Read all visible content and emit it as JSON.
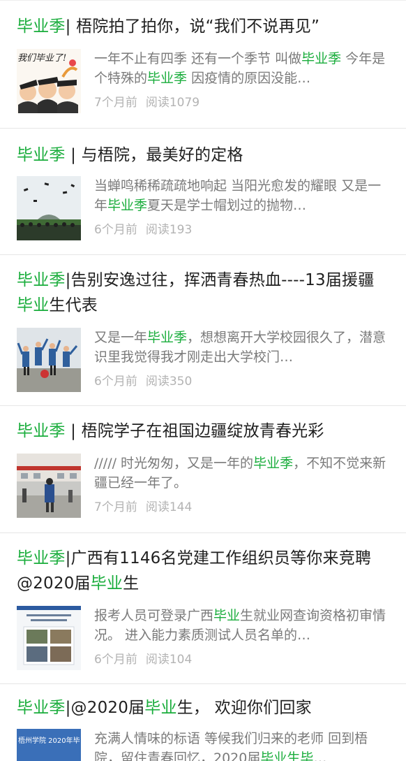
{
  "articles": [
    {
      "title": [
        {
          "t": "毕业季",
          "h": true
        },
        {
          "t": "| 梧院拍了拍你，说“我们不说再见”",
          "h": false
        }
      ],
      "digest": [
        {
          "t": "一年不止有四季 还有一个季节 叫做",
          "h": false
        },
        {
          "t": "毕业季",
          "h": true
        },
        {
          "t": " 今年是个特殊的",
          "h": false
        },
        {
          "t": "毕业季",
          "h": true
        },
        {
          "t": " 因疫情的原因没能…",
          "h": false
        }
      ],
      "time": "7个月前",
      "reads": "阅读1079",
      "thumb": "cartoon-graduates",
      "thumb_text": "我们毕业了!"
    },
    {
      "title": [
        {
          "t": "毕业季",
          "h": true
        },
        {
          "t": " | 与梧院，最美好的定格",
          "h": false
        }
      ],
      "digest": [
        {
          "t": "当蝉鸣稀稀疏疏地响起 当阳光愈发的耀眼 又是一年",
          "h": false
        },
        {
          "t": "毕业季",
          "h": true
        },
        {
          "t": "夏天是学士帽划过的抛物…",
          "h": false
        }
      ],
      "time": "6个月前",
      "reads": "阅读193",
      "thumb": "caps-in-sky",
      "thumb_text": ""
    },
    {
      "title": [
        {
          "t": "毕业季",
          "h": true
        },
        {
          "t": "|告别安逸过往，挥洒青春热血----13届援疆",
          "h": false
        },
        {
          "t": "毕业",
          "h": true
        },
        {
          "t": "生代表",
          "h": false
        }
      ],
      "digest": [
        {
          "t": "又是一年",
          "h": false
        },
        {
          "t": "毕业季",
          "h": true
        },
        {
          "t": "，想想离开大学校园很久了，潜意识里我觉得我才刚走出大学校门…",
          "h": false
        }
      ],
      "time": "6个月前",
      "reads": "阅读350",
      "thumb": "group-jumping",
      "thumb_text": ""
    },
    {
      "title": [
        {
          "t": "毕业季",
          "h": true
        },
        {
          "t": " | 梧院学子在祖国边疆绽放青春光彩",
          "h": false
        }
      ],
      "digest": [
        {
          "t": "///// 时光匆匆，又是一年的",
          "h": false
        },
        {
          "t": "毕业季",
          "h": true
        },
        {
          "t": "，不知不觉来新疆已经一年了。",
          "h": false
        }
      ],
      "time": "7个月前",
      "reads": "阅读144",
      "thumb": "building-people",
      "thumb_text": ""
    },
    {
      "title": [
        {
          "t": "毕业季",
          "h": true
        },
        {
          "t": "|广西有1146名党建工作组织员等你来竞聘@2020届",
          "h": false
        },
        {
          "t": "毕业",
          "h": true
        },
        {
          "t": "生",
          "h": false
        }
      ],
      "digest": [
        {
          "t": "报考人员可登录广西",
          "h": false
        },
        {
          "t": "毕业",
          "h": true
        },
        {
          "t": "生就业网查询资格初审情况。 进入能力素质测试人员名单的…",
          "h": false
        }
      ],
      "time": "6个月前",
      "reads": "阅读104",
      "thumb": "document-cover",
      "thumb_text": ""
    },
    {
      "title": [
        {
          "t": "毕业季",
          "h": true
        },
        {
          "t": "|@2020届",
          "h": false
        },
        {
          "t": "毕业",
          "h": true
        },
        {
          "t": "生， 欢迎你们回家",
          "h": false
        }
      ],
      "digest": [
        {
          "t": "充满人情味的标语 等候我们归来的老师 回到梧院，留住青春回忆，2020届",
          "h": false
        },
        {
          "t": "毕业生毕",
          "h": true
        },
        {
          "t": "…",
          "h": false
        }
      ],
      "time": "",
      "reads": "",
      "thumb": "banner-2020",
      "thumb_text": "梧州学院 2020年毕"
    }
  ]
}
